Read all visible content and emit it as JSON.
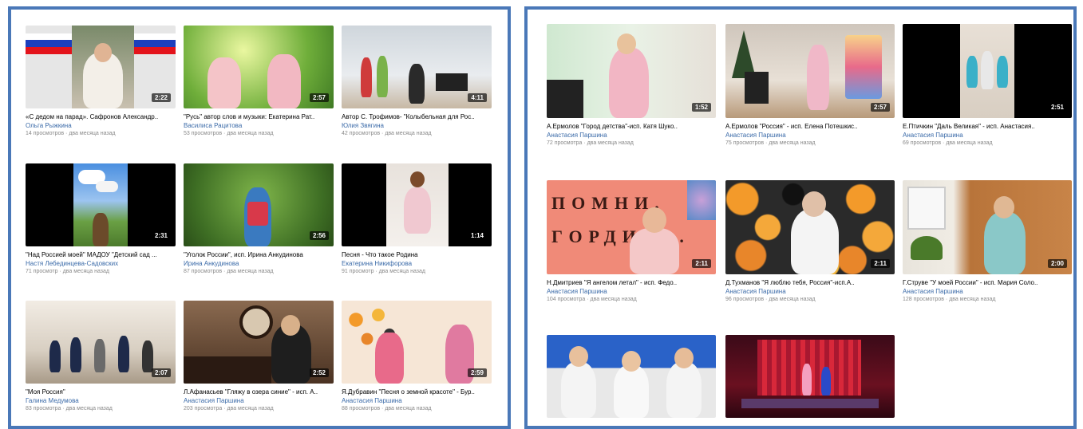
{
  "left_videos": [
    {
      "title": "«С дедом на парад». Сафронов Александр..",
      "author": "Ольга Рыжкина",
      "views": "14 просмотров",
      "age": "два месяца назад",
      "duration": "2:22"
    },
    {
      "title": "\"Русь\" автор слов и музыки: Екатерина Рат..",
      "author": "Василиса Рацитова",
      "views": "53 просмотров",
      "age": "два месяца назад",
      "duration": "2:57"
    },
    {
      "title": "Автор С. Трофимов- \"Колыбельная для Рос..",
      "author": "Юлия Звягина",
      "views": "42 просмотров",
      "age": "два месяца назад",
      "duration": "4:11"
    },
    {
      "title": "\"Над Россией моей\" МАДОУ \"Детский сад ...",
      "author": "Настя Лебединцева-Садовских",
      "views": "71 просмотр",
      "age": "два месяца назад",
      "duration": "2:31"
    },
    {
      "title": "\"Уголок России\", исп. Ирина Анкудинова",
      "author": "Ирина Анкудинова",
      "views": "87 просмотров",
      "age": "два месяца назад",
      "duration": "2:56"
    },
    {
      "title": "Песня - Что такое Родина",
      "author": "Екатерина Никифорова",
      "views": "91 просмотр",
      "age": "два месяца назад",
      "duration": "1:14"
    },
    {
      "title": "\"Моя Россия\"",
      "author": "Галина Медумова",
      "views": "83 просмотра",
      "age": "два месяца назад",
      "duration": "2:07"
    },
    {
      "title": "Л.Афанасьев \"Гляжу в озера синие\" - исп. А..",
      "author": "Анастасия Паршина",
      "views": "203 просмотра",
      "age": "два месяца назад",
      "duration": "2:52"
    },
    {
      "title": "Я.Дубравин \"Песня о земной красоте\" - Бур..",
      "author": "Анастасия Паршина",
      "views": "88 просмотров",
      "age": "два месяца назад",
      "duration": "2:59"
    }
  ],
  "right_videos": [
    {
      "title": "А.Ермолов \"Город детства\"-исп. Катя Шуко..",
      "author": "Анастасия Паршина",
      "views": "72 просмотра",
      "age": "два месяца назад",
      "duration": "1:52"
    },
    {
      "title": "А.Ермолов \"Россия\" - исп. Елена Потешкис..",
      "author": "Анастасия Паршина",
      "views": "75 просмотров",
      "age": "два месяца назад",
      "duration": "2:57"
    },
    {
      "title": "Е.Птичкин \"Даль Великая\" - исп. Анастасия..",
      "author": "Анастасия Паршина",
      "views": "69 просмотров",
      "age": "два месяца назад",
      "duration": "2:51"
    },
    {
      "title": "Н.Дмитриев \"Я ангелом летал\" - исп. Федо..",
      "author": "Анастасия Паршина",
      "views": "104 просмотра",
      "age": "два месяца назад",
      "duration": "2:11"
    },
    {
      "title": "Д.Тухманов \"Я люблю тебя, Россия\"-исп.А..",
      "author": "Анастасия Паршина",
      "views": "96 просмотров",
      "age": "два месяца назад",
      "duration": "2:11"
    },
    {
      "title": "Г.Струве \"У моей России\" - исп. Мария Соло..",
      "author": "Анастасия Паршина",
      "views": "128 просмотров",
      "age": "два месяца назад",
      "duration": "2:00"
    },
    {
      "title": "",
      "author": "",
      "views": "",
      "age": "",
      "duration": ""
    },
    {
      "title": "",
      "author": "",
      "views": "",
      "age": "",
      "duration": ""
    }
  ],
  "thumb_text": {
    "banner_line1": "ПОМНИ.",
    "banner_line2": "ГОРДИСЬ."
  },
  "colors": {
    "border": "#4a78b8",
    "author": "#3a6aa8",
    "meta": "#888888"
  }
}
